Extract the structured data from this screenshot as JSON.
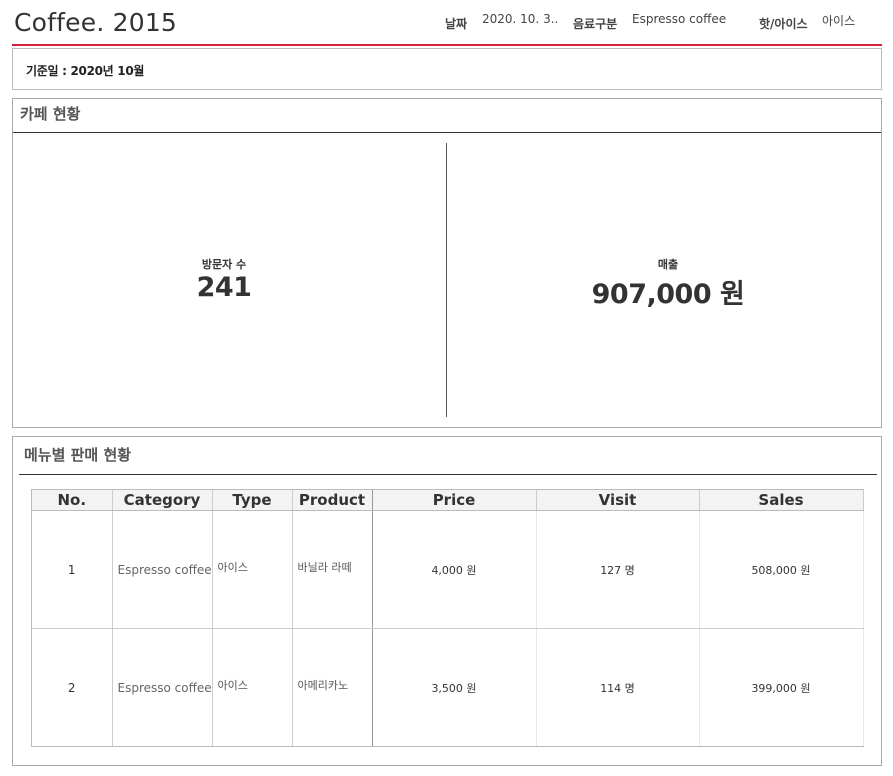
{
  "header": {
    "app_title": "Coffee. 2015",
    "filters": [
      {
        "label": "날짜",
        "value": "2020. 10. 3.."
      },
      {
        "label": "음료구분",
        "value": "Espresso coffee"
      },
      {
        "label": "핫/아이스",
        "value": "아이스"
      }
    ]
  },
  "basis": {
    "text": "기준일 : 2020년 10월"
  },
  "cafe_status": {
    "title": "카페 현황",
    "visitors": {
      "label": "방문자 수",
      "value": "241"
    },
    "sales": {
      "label": "매출",
      "value": "907,000 원"
    }
  },
  "menu_sales": {
    "title": "메뉴별 판매 현황",
    "columns": [
      "No.",
      "Category",
      "Type",
      "Product",
      "Price",
      "Visit",
      "Sales"
    ],
    "rows": [
      {
        "no": "1",
        "category": "Espresso coffee",
        "type": "아이스",
        "product": "바닐라 라떼",
        "price": "4,000 원",
        "visit": "127 명",
        "sales": "508,000 원"
      },
      {
        "no": "2",
        "category": "Espresso coffee",
        "type": "아이스",
        "product": "아메리카노",
        "price": "3,500 원",
        "visit": "114 명",
        "sales": "399,000 원"
      }
    ]
  },
  "colors": {
    "accent": "#d6213a"
  }
}
